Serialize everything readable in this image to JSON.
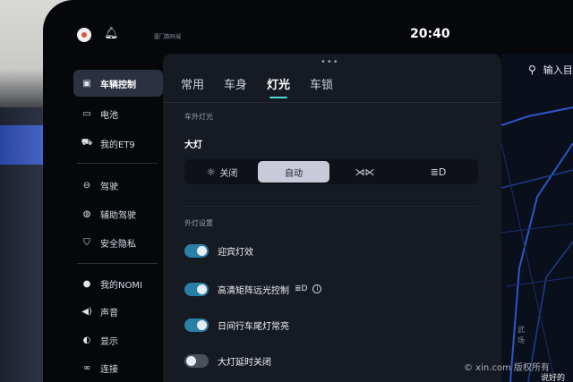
{
  "status_bar": {
    "location_text": "厦门数码城",
    "time": "20:40"
  },
  "sidebar": {
    "items": [
      {
        "label": "车辆控制",
        "icon": "car-control-icon",
        "active": true
      },
      {
        "label": "电池",
        "icon": "battery-icon"
      },
      {
        "label": "我的ET9",
        "icon": "car-icon"
      },
      {
        "label": "驾驶",
        "icon": "steering-icon"
      },
      {
        "label": "辅助驾驶",
        "icon": "assist-drive-icon"
      },
      {
        "label": "安全隐私",
        "icon": "shield-icon"
      },
      {
        "label": "我的NOMI",
        "icon": "nomi-icon"
      },
      {
        "label": "声音",
        "icon": "speaker-icon"
      },
      {
        "label": "显示",
        "icon": "display-icon"
      },
      {
        "label": "连接",
        "icon": "link-icon"
      }
    ]
  },
  "tabs": [
    {
      "label": "常用"
    },
    {
      "label": "车身"
    },
    {
      "label": "灯光",
      "active": true
    },
    {
      "label": "车锁"
    }
  ],
  "exterior": {
    "section_title": "车外灯光",
    "headlight_label": "大灯",
    "options": [
      {
        "label": "关闭",
        "icon": "sun-icon"
      },
      {
        "label": "自动",
        "active": true
      },
      {
        "label": "",
        "icon": "position-light-icon"
      },
      {
        "label": "",
        "icon": "low-beam-icon"
      }
    ]
  },
  "settings": {
    "section_title": "外灯设置",
    "rows": [
      {
        "label": "迎宾灯效",
        "on": true
      },
      {
        "label": "高清矩阵远光控制",
        "on": true
      },
      {
        "label": "日间行车尾灯常亮",
        "on": true
      },
      {
        "label": "大灯延时关闭",
        "on": false
      }
    ]
  },
  "map": {
    "search_placeholder": "输入目",
    "labels": [
      "武",
      "场"
    ],
    "banner": "说好的"
  },
  "watermark": "© xin.com 版权所有",
  "colors": {
    "accent": "#53d4d6",
    "toggle_on": "#2a7fa7",
    "panel_bg": "#161a22",
    "segment_active": "#c9cad9"
  }
}
